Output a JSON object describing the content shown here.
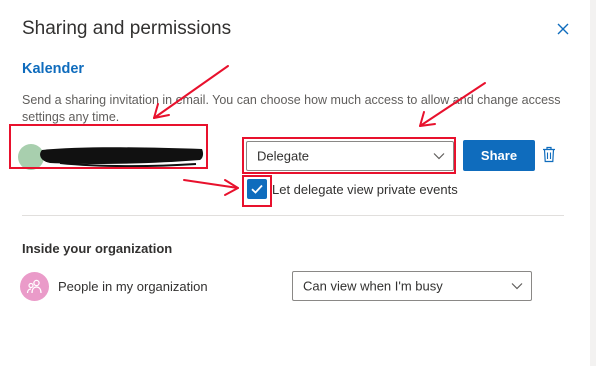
{
  "dialog": {
    "title": "Sharing and permissions",
    "calendar_name": "Kalender",
    "description": "Send a sharing invitation in email. You can choose how much access to allow and change access settings any time."
  },
  "invite": {
    "permission_value": "Delegate",
    "share_label": "Share",
    "private_events_label": "Let delegate view private events",
    "private_events_checked": true
  },
  "organization": {
    "section_title": "Inside your organization",
    "people_label": "People in my organization",
    "permission_value": "Can view when I'm busy"
  },
  "colors": {
    "accent": "#0f6cbd",
    "annotation": "#e8112d",
    "org_avatar": "#ea9bc9"
  },
  "icons": [
    "close-icon",
    "chevron-down-icon",
    "trash-icon",
    "checkmark-icon",
    "people-icon"
  ]
}
